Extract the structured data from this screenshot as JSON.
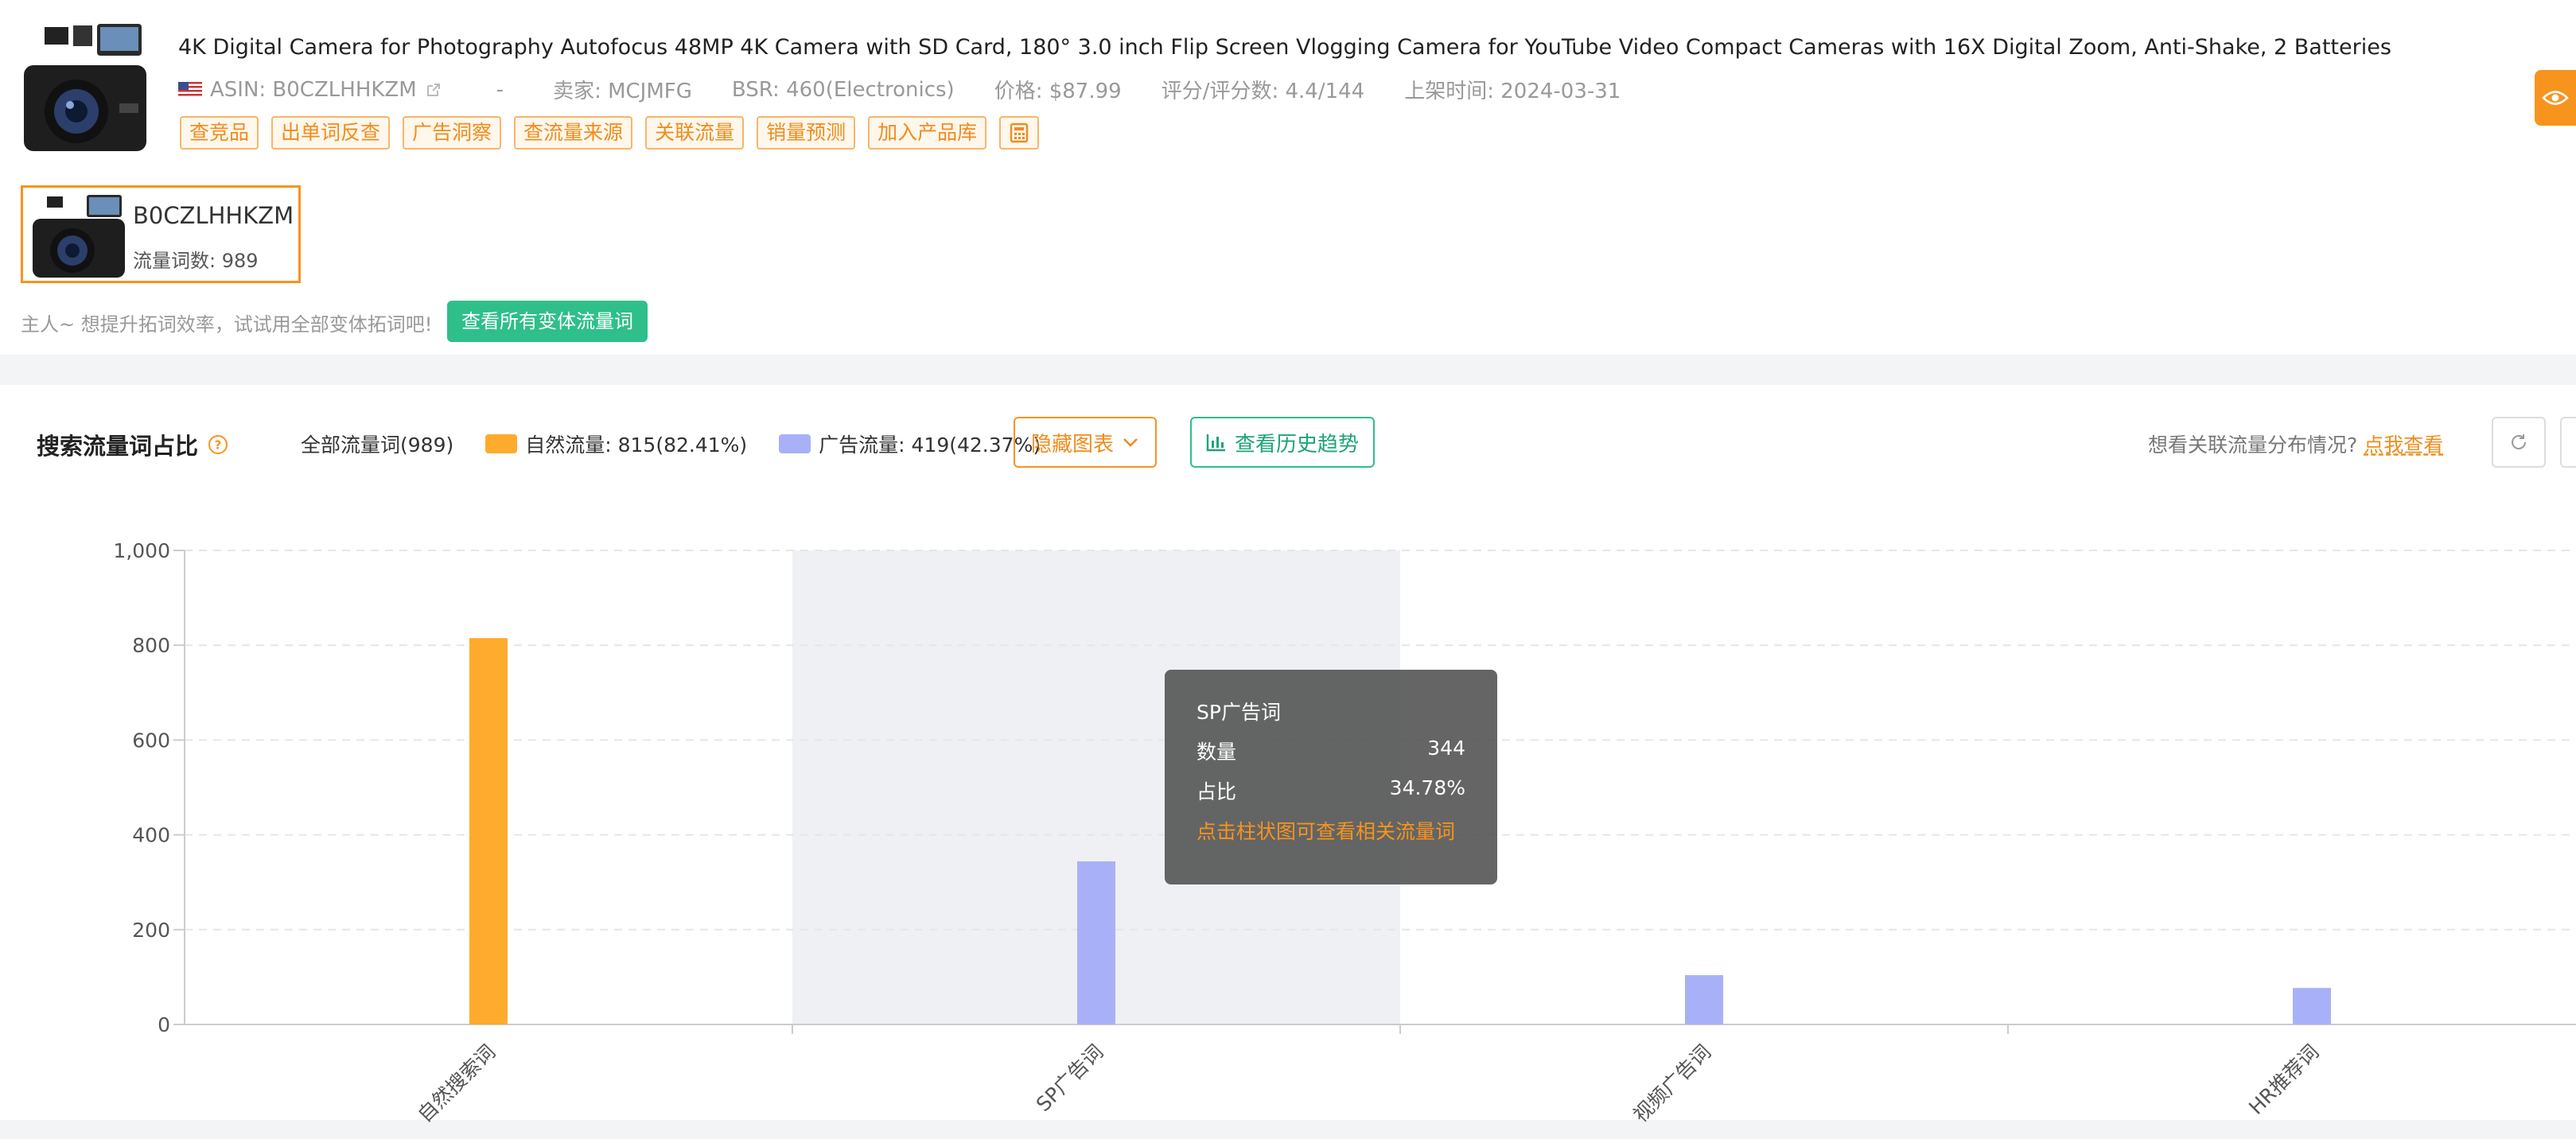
{
  "product": {
    "title": "4K Digital Camera for Photography Autofocus 48MP 4K Camera with SD Card, 180° 3.0 inch Flip Screen Vlogging Camera for YouTube Video Compact Cameras with 16X Digital Zoom, Anti-Shake, 2 Batteries",
    "asin": "ASIN: B0CZLHHKZM",
    "dash": "-",
    "seller": "卖家: MCJMFG",
    "bsr": "BSR: 460(Electronics)",
    "price": "价格: $87.99",
    "rating": "评分/评分数: 4.4/144",
    "listed": "上架时间: 2024-03-31",
    "tags": [
      "查竞品",
      "出单词反查",
      "广告洞察",
      "查流量来源",
      "关联流量",
      "销量预测",
      "加入产品库"
    ]
  },
  "variant": {
    "asin": "B0CZLHHKZM",
    "count": "流量词数: 989"
  },
  "hint": {
    "text": "主人~ 想提升拓词效率，试试用全部变体拓词吧!",
    "button": "查看所有变体流量词"
  },
  "panel": {
    "title": "搜索流量词占比",
    "all_words": "全部流量词(989)",
    "organic": "自然流量: 815(82.41%)",
    "ads": "广告流量: 419(42.37%)",
    "hide_chart": "隐藏图表",
    "history": "查看历史趋势",
    "related_q": "想看关联流量分布情况?",
    "related_link": "点我查看"
  },
  "colors": {
    "organic": "#ffab2e",
    "ads": "#a8b1f8",
    "accent": "#f7941d",
    "green": "#2ebf8b"
  },
  "chart_data": {
    "type": "bar",
    "categories": [
      "自然搜索词",
      "SP广告词",
      "视频广告词",
      "HR推荐词"
    ],
    "values": [
      815,
      344,
      104,
      77
    ],
    "bar_colors": [
      "#ffab2e",
      "#a8b1f8",
      "#a8b1f8",
      "#a8b1f8"
    ],
    "ylim": [
      0,
      1000
    ],
    "yticks": [
      "0",
      "200",
      "400",
      "600",
      "800",
      "1,000"
    ],
    "highlighted_category": "SP广告词",
    "grid": true
  },
  "tooltip": {
    "title": "SP广告词",
    "qty_label": "数量",
    "qty_value": "344",
    "ratio_label": "占比",
    "ratio_value": "34.78%",
    "tip": "点击柱状图可查看相关流量词"
  }
}
